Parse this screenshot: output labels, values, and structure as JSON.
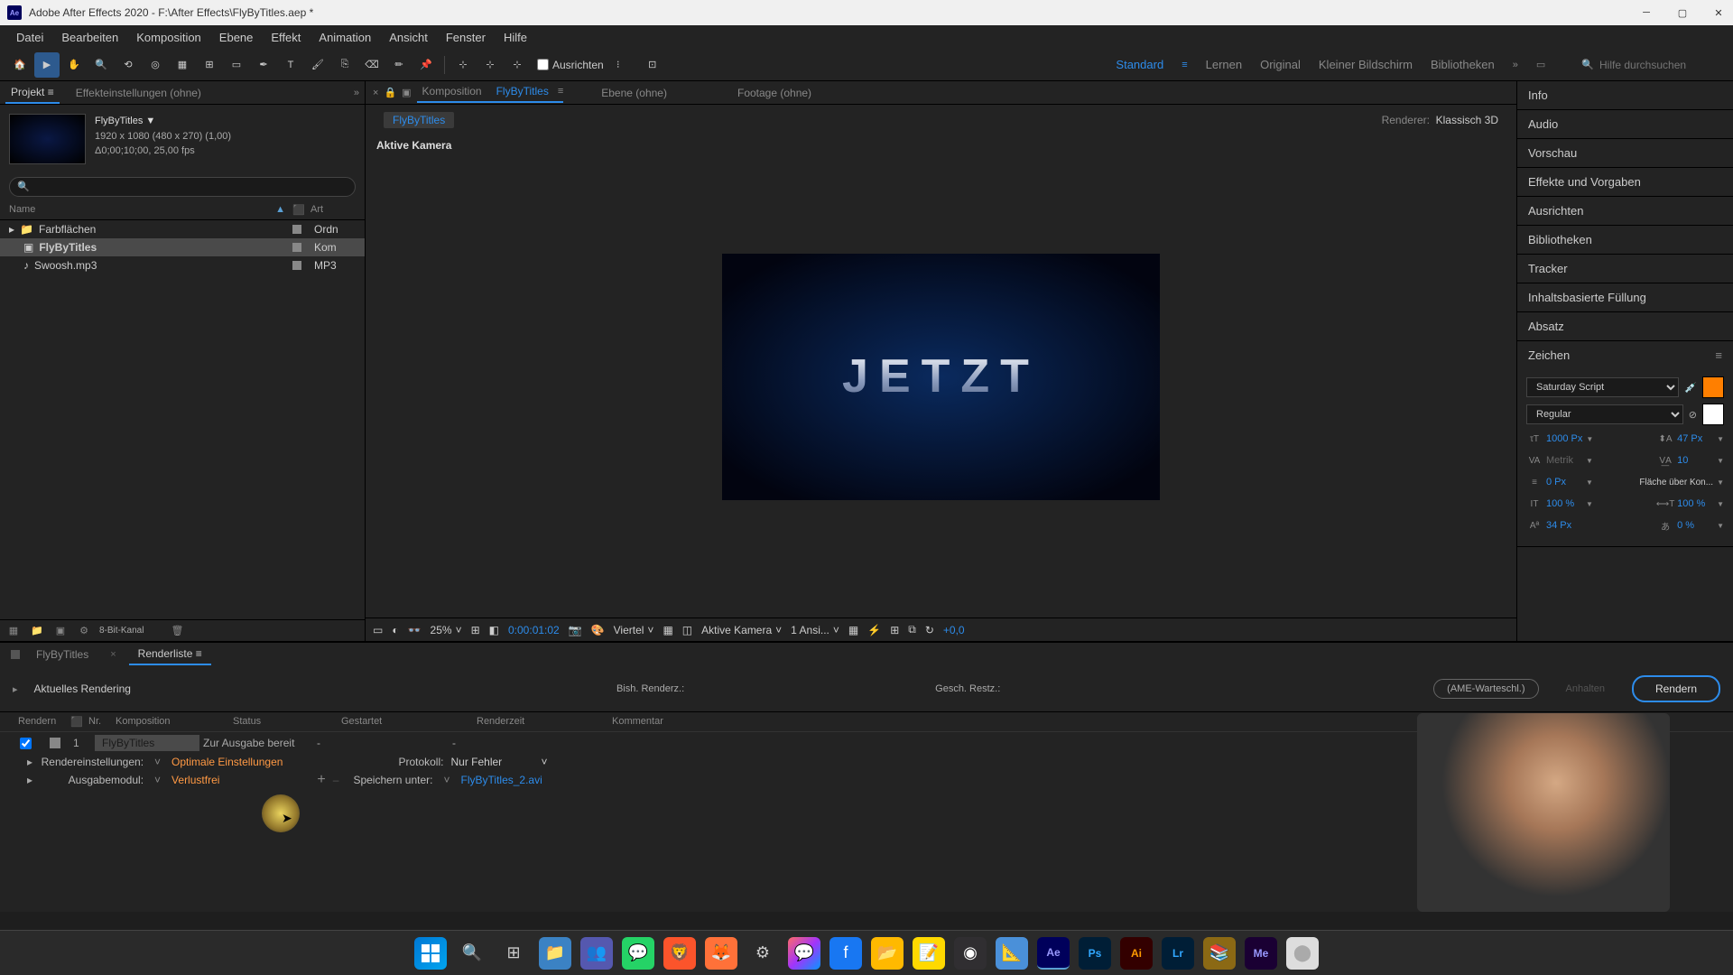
{
  "titlebar": {
    "text": "Adobe After Effects 2020 - F:\\After Effects\\FlyByTitles.aep *"
  },
  "menubar": {
    "items": [
      "Datei",
      "Bearbeiten",
      "Komposition",
      "Ebene",
      "Effekt",
      "Animation",
      "Ansicht",
      "Fenster",
      "Hilfe"
    ]
  },
  "toolbar": {
    "align_label": "Ausrichten",
    "workspaces": [
      "Standard",
      "Lernen",
      "Original",
      "Kleiner Bildschirm",
      "Bibliotheken"
    ],
    "active_workspace": "Standard",
    "search_placeholder": "Hilfe durchsuchen"
  },
  "project_panel": {
    "tab_project": "Projekt",
    "tab_effects": "Effekteinstellungen (ohne)",
    "comp_name": "FlyByTitles",
    "meta_line1": "1920 x 1080 (480 x 270) (1,00)",
    "meta_line2": "Δ0;00;10;00, 25,00 fps",
    "col_name": "Name",
    "col_type": "Art",
    "items": [
      {
        "name": "Farbflächen",
        "type": "Ordn",
        "kind": "folder"
      },
      {
        "name": "FlyByTitles",
        "type": "Kom",
        "kind": "comp",
        "selected": true
      },
      {
        "name": "Swoosh.mp3",
        "type": "MP3",
        "kind": "audio"
      }
    ],
    "bpc_label": "8-Bit-Kanal"
  },
  "comp_viewer": {
    "tab_comp_prefix": "Komposition",
    "tab_comp_name": "FlyByTitles",
    "tab_layer": "Ebene (ohne)",
    "tab_footage": "Footage (ohne)",
    "breadcrumb": "FlyByTitles",
    "renderer_label": "Renderer:",
    "renderer_value": "Klassisch 3D",
    "active_camera": "Aktive Kamera",
    "preview_text": "JETZT",
    "zoom": "25%",
    "timecode": "0:00:01:02",
    "resolution": "Viertel",
    "view_camera": "Aktive Kamera",
    "view_count": "1 Ansi...",
    "exposure": "+0,0"
  },
  "side_panels": {
    "info": "Info",
    "audio": "Audio",
    "preview": "Vorschau",
    "effects_presets": "Effekte und Vorgaben",
    "align": "Ausrichten",
    "libraries": "Bibliotheken",
    "tracker": "Tracker",
    "content_fill": "Inhaltsbasierte Füllung",
    "paragraph": "Absatz",
    "character": "Zeichen"
  },
  "character_panel": {
    "font_family": "Saturday Script",
    "font_style": "Regular",
    "font_size": "1000 Px",
    "leading": "47 Px",
    "kerning": "Metrik",
    "tracking": "10",
    "stroke": "0 Px",
    "stroke_opt": "Fläche über Kon...",
    "vscale": "100 %",
    "hscale": "100 %",
    "baseline": "34 Px",
    "tsume": "0 %"
  },
  "render_queue": {
    "tab_comp": "FlyByTitles",
    "tab_render": "Renderliste",
    "current_label": "Aktuelles Rendering",
    "bish_label": "Bish. Renderz.:",
    "gesch_label": "Gesch. Restz.:",
    "ame_btn": "(AME-Warteschl.)",
    "stop_btn": "Anhalten",
    "render_btn": "Rendern",
    "cols": {
      "render": "Rendern",
      "nr": "Nr.",
      "comp": "Komposition",
      "status": "Status",
      "started": "Gestartet",
      "rendertime": "Renderzeit",
      "comment": "Kommentar"
    },
    "item": {
      "nr": "1",
      "comp": "FlyByTitles",
      "status": "Zur Ausgabe bereit",
      "started": "-",
      "rendertime": "-"
    },
    "settings_label": "Rendereinstellungen:",
    "settings_value": "Optimale Einstellungen",
    "output_label": "Ausgabemodul:",
    "output_value": "Verlustfrei",
    "protocol_label": "Protokoll:",
    "protocol_value": "Nur Fehler",
    "saveas_label": "Speichern unter:",
    "saveas_value": "FlyByTitles_2.avi"
  },
  "chart_data": null
}
